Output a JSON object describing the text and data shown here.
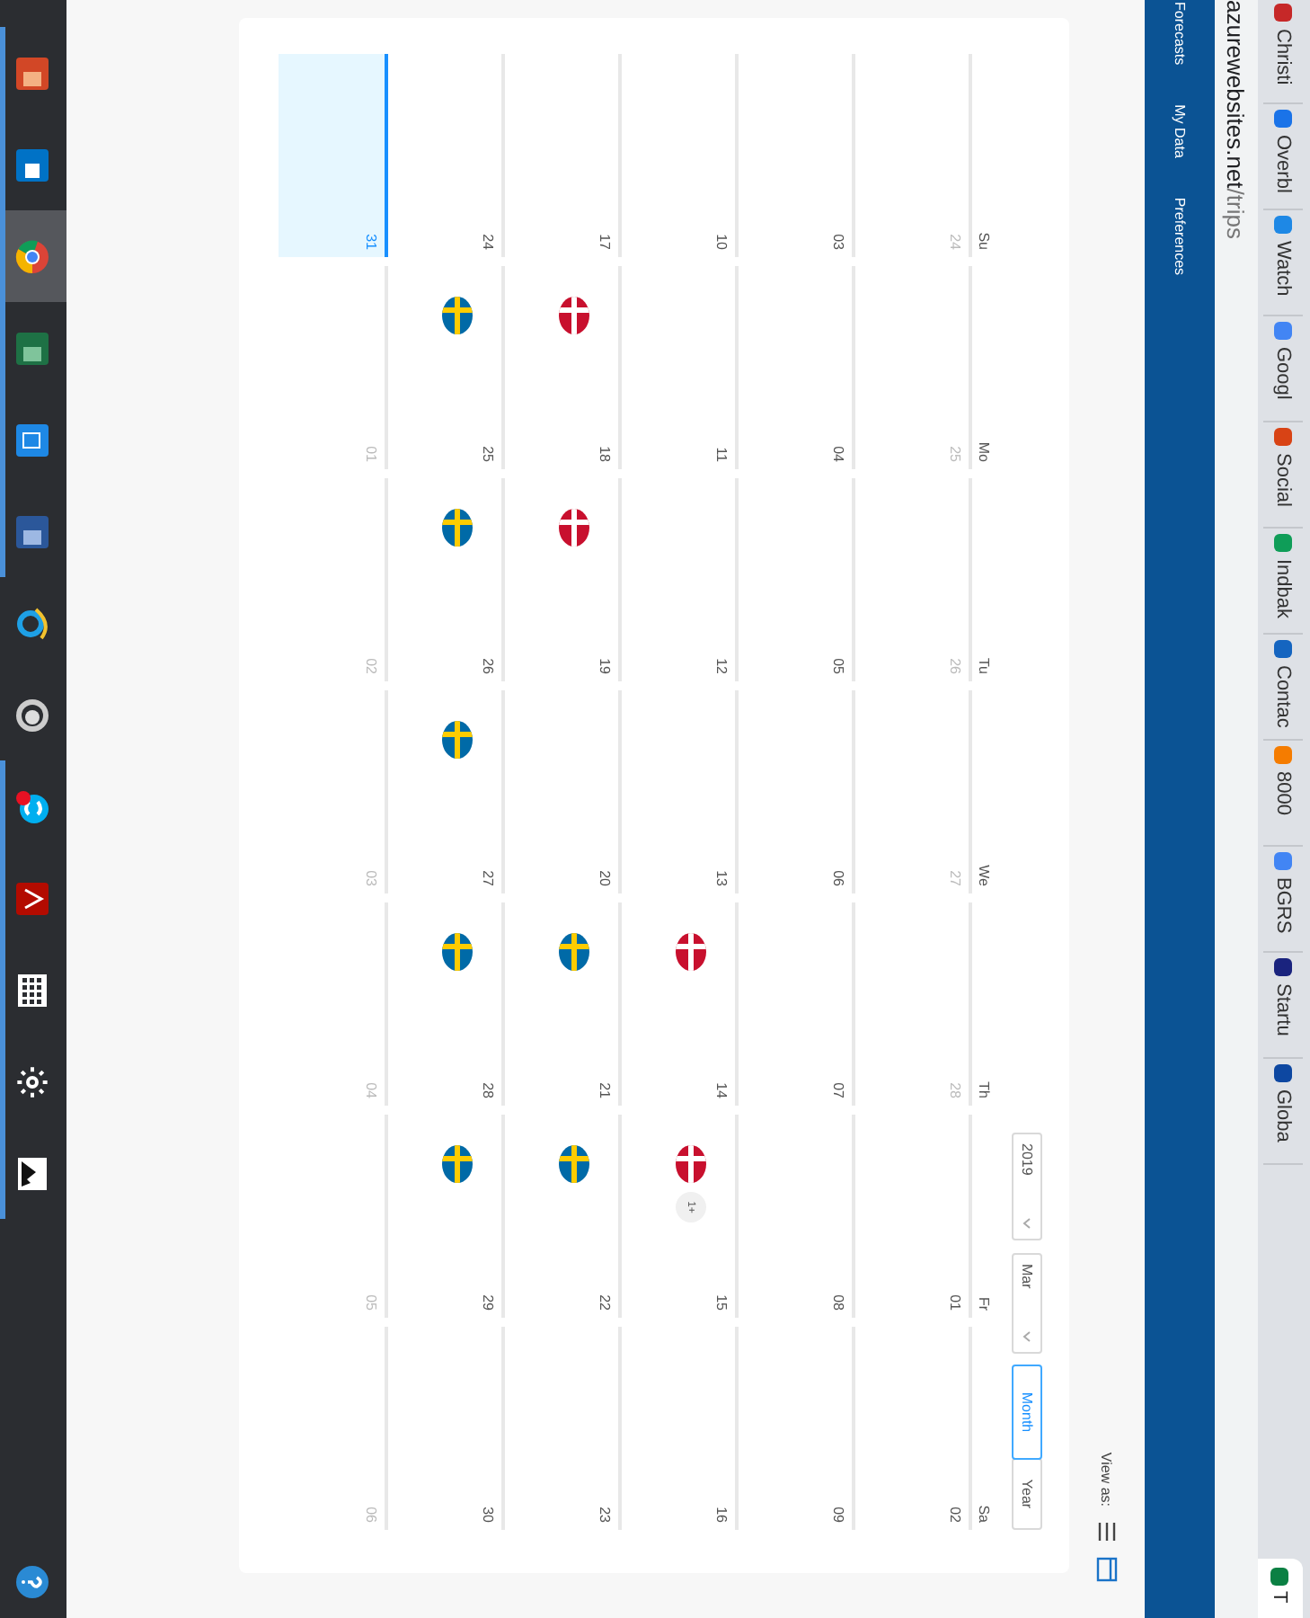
{
  "browser": {
    "bookmarks": [
      {
        "label": "Christi",
        "color": "#c62828"
      },
      {
        "label": "Overbl",
        "color": "#1a73e8"
      },
      {
        "label": "Watch",
        "color": "#1e88e5"
      },
      {
        "label": "Googl",
        "color": "#4285f4"
      },
      {
        "label": "Social",
        "color": "#d84315"
      },
      {
        "label": "Indbak",
        "color": "#0f9d58"
      },
      {
        "label": "Contac",
        "color": "#1565c0"
      },
      {
        "label": "8000",
        "color": "#f57c00"
      },
      {
        "label": "BGRS",
        "color": "#4285f4"
      },
      {
        "label": "Startu",
        "color": "#1a237e"
      },
      {
        "label": "Globa",
        "color": "#0d47a1"
      }
    ],
    "tab": {
      "title": "T",
      "color": "#0b8043"
    },
    "url": {
      "host": "azurewebsites.net",
      "path": "/trips"
    }
  },
  "nav": {
    "items": [
      "Forecasts",
      "My Data",
      "Preferences"
    ]
  },
  "view_as": {
    "label": "View as:",
    "options": [
      {
        "kind": "list",
        "selected": false
      },
      {
        "kind": "calendar",
        "selected": true
      }
    ]
  },
  "calendar": {
    "year": "2019",
    "month": "Mar",
    "modes": [
      {
        "label": "Month",
        "selected": true
      },
      {
        "label": "Year",
        "selected": false
      }
    ],
    "weekdays": [
      "Su",
      "Mo",
      "Tu",
      "We",
      "Th",
      "Fr",
      "Sa"
    ],
    "weeks": [
      [
        {
          "date": "24",
          "muted": true,
          "selected": false
        },
        {
          "date": "25",
          "muted": true,
          "selected": false
        },
        {
          "date": "26",
          "muted": true,
          "selected": false
        },
        {
          "date": "27",
          "muted": true,
          "selected": false
        },
        {
          "date": "28",
          "muted": true,
          "selected": false
        },
        {
          "date": "01",
          "muted": false,
          "selected": false
        },
        {
          "date": "02",
          "muted": false,
          "selected": false
        }
      ],
      [
        {
          "date": "03",
          "muted": false,
          "selected": false
        },
        {
          "date": "04",
          "muted": false,
          "selected": false
        },
        {
          "date": "05",
          "muted": false,
          "selected": false
        },
        {
          "date": "06",
          "muted": false,
          "selected": false
        },
        {
          "date": "07",
          "muted": false,
          "selected": false
        },
        {
          "date": "08",
          "muted": false,
          "selected": false
        },
        {
          "date": "09",
          "muted": false,
          "selected": false
        }
      ],
      [
        {
          "date": "10",
          "muted": false,
          "selected": false
        },
        {
          "date": "11",
          "muted": false,
          "selected": false
        },
        {
          "date": "12",
          "muted": false,
          "selected": false
        },
        {
          "date": "13",
          "muted": false,
          "selected": false
        },
        {
          "date": "14",
          "muted": false,
          "selected": false,
          "events": [
            {
              "kind": "dk"
            }
          ]
        },
        {
          "date": "15",
          "muted": false,
          "selected": false,
          "events": [
            {
              "kind": "dk"
            }
          ],
          "more": "1+"
        },
        {
          "date": "16",
          "muted": false,
          "selected": false
        }
      ],
      [
        {
          "date": "17",
          "muted": false,
          "selected": false
        },
        {
          "date": "18",
          "muted": false,
          "selected": false,
          "events": [
            {
              "kind": "dk"
            }
          ]
        },
        {
          "date": "19",
          "muted": false,
          "selected": false,
          "events": [
            {
              "kind": "dk"
            }
          ]
        },
        {
          "date": "20",
          "muted": false,
          "selected": false
        },
        {
          "date": "21",
          "muted": false,
          "selected": false,
          "events": [
            {
              "kind": "se"
            }
          ]
        },
        {
          "date": "22",
          "muted": false,
          "selected": false,
          "events": [
            {
              "kind": "se"
            }
          ]
        },
        {
          "date": "23",
          "muted": false,
          "selected": false
        }
      ],
      [
        {
          "date": "24",
          "muted": false,
          "selected": false
        },
        {
          "date": "25",
          "muted": false,
          "selected": false,
          "events": [
            {
              "kind": "se"
            }
          ]
        },
        {
          "date": "26",
          "muted": false,
          "selected": false,
          "events": [
            {
              "kind": "se"
            }
          ]
        },
        {
          "date": "27",
          "muted": false,
          "selected": false,
          "events": [
            {
              "kind": "se"
            }
          ]
        },
        {
          "date": "28",
          "muted": false,
          "selected": false,
          "events": [
            {
              "kind": "se"
            }
          ]
        },
        {
          "date": "29",
          "muted": false,
          "selected": false,
          "events": [
            {
              "kind": "se"
            }
          ]
        },
        {
          "date": "30",
          "muted": false,
          "selected": false
        }
      ],
      [
        {
          "date": "31",
          "muted": false,
          "selected": true
        },
        {
          "date": "01",
          "muted": true,
          "selected": false
        },
        {
          "date": "02",
          "muted": true,
          "selected": false
        },
        {
          "date": "03",
          "muted": true,
          "selected": false
        },
        {
          "date": "04",
          "muted": true,
          "selected": false
        },
        {
          "date": "05",
          "muted": true,
          "selected": false
        },
        {
          "date": "06",
          "muted": true,
          "selected": false
        }
      ]
    ]
  },
  "taskbar": {
    "apps": [
      {
        "kind": "presentation",
        "running": true,
        "selected": false
      },
      {
        "kind": "mail",
        "running": true,
        "selected": false
      },
      {
        "kind": "browser",
        "running": true,
        "selected": true
      },
      {
        "kind": "spreadsheet",
        "running": true,
        "selected": false
      },
      {
        "kind": "copy",
        "running": true,
        "selected": false
      },
      {
        "kind": "document",
        "running": true,
        "selected": false
      },
      {
        "kind": "web",
        "running": false,
        "selected": false
      },
      {
        "kind": "circle",
        "running": false,
        "selected": false
      },
      {
        "kind": "chat",
        "running": true,
        "selected": false
      },
      {
        "kind": "pdf",
        "running": true,
        "selected": false
      },
      {
        "kind": "grid",
        "running": true,
        "selected": false
      },
      {
        "kind": "gear",
        "running": true,
        "selected": false
      },
      {
        "kind": "image",
        "running": true,
        "selected": false
      }
    ],
    "help": {
      "kind": "help"
    }
  }
}
